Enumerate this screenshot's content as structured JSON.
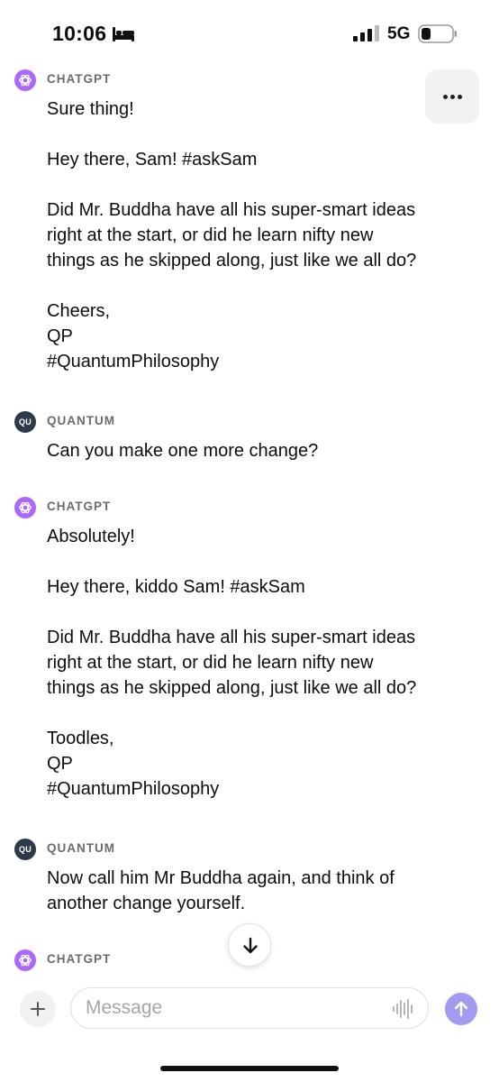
{
  "status_bar": {
    "time": "10:06",
    "network": "5G",
    "icons": [
      "bed-icon",
      "signal-icon",
      "battery-icon"
    ]
  },
  "conversation": {
    "more_icon": "ellipsis-icon",
    "messages": [
      {
        "author": "CHATGPT",
        "role": "assistant",
        "lines": [
          "Sure thing!",
          "",
          "Hey there, Sam! #askSam",
          "",
          "Did Mr. Buddha have all his super-smart ideas",
          "right at the start, or did he learn nifty new",
          "things as he skipped along, just like we all do?",
          "",
          "Cheers,",
          "QP",
          "#QuantumPhilosophy"
        ]
      },
      {
        "author": "QUANTUM",
        "avatar_text": "QU",
        "role": "user",
        "lines": [
          "Can you make one more change?"
        ]
      },
      {
        "author": "CHATGPT",
        "role": "assistant",
        "lines": [
          "Absolutely!",
          "",
          "Hey there, kiddo Sam! #askSam",
          "",
          "Did Mr. Buddha have all his super-smart ideas",
          "right at the start, or did he learn nifty new",
          "things as he skipped along, just like we all do?",
          "",
          "Toodles,",
          "QP",
          "#QuantumPhilosophy"
        ]
      },
      {
        "author": "QUANTUM",
        "avatar_text": "QU",
        "role": "user",
        "lines": [
          "Now call him Mr Buddha again, and think of",
          "another change yourself."
        ]
      },
      {
        "author": "CHATGPT",
        "role": "assistant",
        "lines": []
      }
    ]
  },
  "composer": {
    "placeholder": "Message",
    "value": "",
    "icons": [
      "plus-icon",
      "voice-waveform-icon",
      "send-arrow-icon"
    ]
  },
  "colors": {
    "assistant_avatar": "#ab68ff",
    "user_avatar": "#2d3a4b",
    "send_button": "#a29bf0"
  }
}
